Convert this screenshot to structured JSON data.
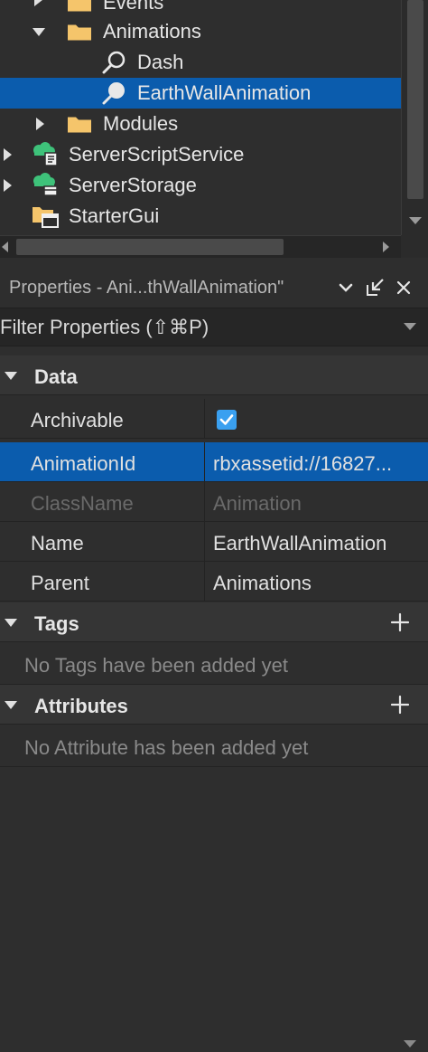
{
  "explorer": {
    "items": [
      {
        "label": "Events"
      },
      {
        "label": "Animations"
      },
      {
        "label": "Dash"
      },
      {
        "label": "EarthWallAnimation"
      },
      {
        "label": "Modules"
      },
      {
        "label": "ServerScriptService"
      },
      {
        "label": "ServerStorage"
      },
      {
        "label": "StarterGui"
      }
    ]
  },
  "properties": {
    "title": "Properties - Ani...thWallAnimation\"",
    "filter_placeholder": "Filter Properties (⇧⌘P)",
    "sections": {
      "data": "Data",
      "tags": "Tags",
      "attributes": "Attributes"
    },
    "rows": [
      {
        "name": "Archivable",
        "value": ""
      },
      {
        "name": "AnimationId",
        "value": "rbxassetid://16827..."
      },
      {
        "name": "ClassName",
        "value": "Animation"
      },
      {
        "name": "Name",
        "value": "EarthWallAnimation"
      },
      {
        "name": "Parent",
        "value": "Animations"
      }
    ],
    "tags_empty": "No Tags have been added yet",
    "attributes_empty": "No Attribute has been added yet"
  },
  "colors": {
    "selection": "#0b5cad",
    "checkbox": "#3aa0f0",
    "folder": "#f5c56b",
    "service_green": "#3ec27a"
  }
}
